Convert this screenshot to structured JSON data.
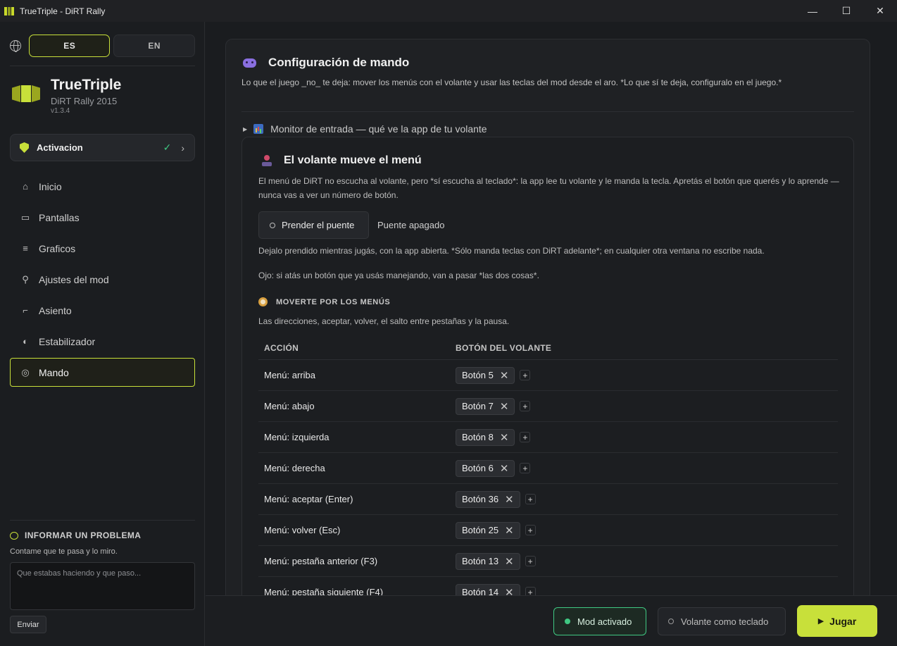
{
  "window": {
    "title": "TrueTriple - DiRT Rally",
    "minimize": "—",
    "maximize": "☐",
    "close": "✕"
  },
  "sidebar": {
    "lang": {
      "es": "ES",
      "en": "EN",
      "active": "ES"
    },
    "brand": {
      "name": "TrueTriple",
      "game": "DiRT Rally 2015",
      "version": "v1.3.4"
    },
    "activation": {
      "label": "Activacion",
      "check": "✓",
      "chevron": "›"
    },
    "nav": [
      {
        "label": "Inicio",
        "icon": "⌂"
      },
      {
        "label": "Pantallas",
        "icon": "▭"
      },
      {
        "label": "Graficos",
        "icon": "≡"
      },
      {
        "label": "Ajustes del mod",
        "icon": "⚲"
      },
      {
        "label": "Asiento",
        "icon": "⌐"
      },
      {
        "label": "Estabilizador",
        "icon": "◐"
      },
      {
        "label": "Mando",
        "icon": "◎",
        "active": true
      }
    ],
    "report": {
      "title": "INFORMAR UN PROBLEMA",
      "subtitle": "Contame que te pasa y lo miro.",
      "placeholder": "Que estabas haciendo y que paso...",
      "send": "Enviar"
    }
  },
  "main": {
    "title": "Configuración de mando",
    "subtitle": "Lo que el juego _no_ te deja: mover los menús con el volante y usar las teclas del mod desde el aro. *Lo que sí te deja, configuralo en el juego.*",
    "monitor": "Monitor de entrada — qué ve la app de tu volante",
    "section": {
      "title": "El volante mueve el menú",
      "desc": "El menú de DiRT no escucha al volante, pero *sí escucha al teclado*: la app lee tu volante y le manda la tecla. Apretás el botón que querés y lo aprende — nunca vas a ver un número de botón.",
      "bridge_button": "Prender el puente",
      "bridge_status": "Puente apagado",
      "note1": "Dejalo prendido mientras jugás, con la app abierta. *Sólo manda teclas con DiRT adelante*; en cualquier otra ventana no escribe nada.",
      "note2": "Ojo: si atás un botón que ya usás manejando, van a pasar *las dos cosas*.",
      "nav_title": "MOVERTE POR LOS MENÚS",
      "nav_desc": "Las direcciones, aceptar, volver, el salto entre pestañas y la pausa.",
      "table": {
        "col_action": "ACCIÓN",
        "col_button": "BOTÓN DEL VOLANTE",
        "rows": [
          {
            "action": "Menú: arriba",
            "button": "Botón 5"
          },
          {
            "action": "Menú: abajo",
            "button": "Botón 7"
          },
          {
            "action": "Menú: izquierda",
            "button": "Botón 8"
          },
          {
            "action": "Menú: derecha",
            "button": "Botón 6"
          },
          {
            "action": "Menú: aceptar (Enter)",
            "button": "Botón 36"
          },
          {
            "action": "Menú: volver (Esc)",
            "button": "Botón 25"
          },
          {
            "action": "Menú: pestaña anterior (F3)",
            "button": "Botón 13"
          },
          {
            "action": "Menú: pestaña siguiente (F4)",
            "button": "Botón 14"
          }
        ]
      }
    }
  },
  "footer": {
    "mod": "Mod activado",
    "wheel": "Volante como teclado",
    "play": "Jugar"
  }
}
